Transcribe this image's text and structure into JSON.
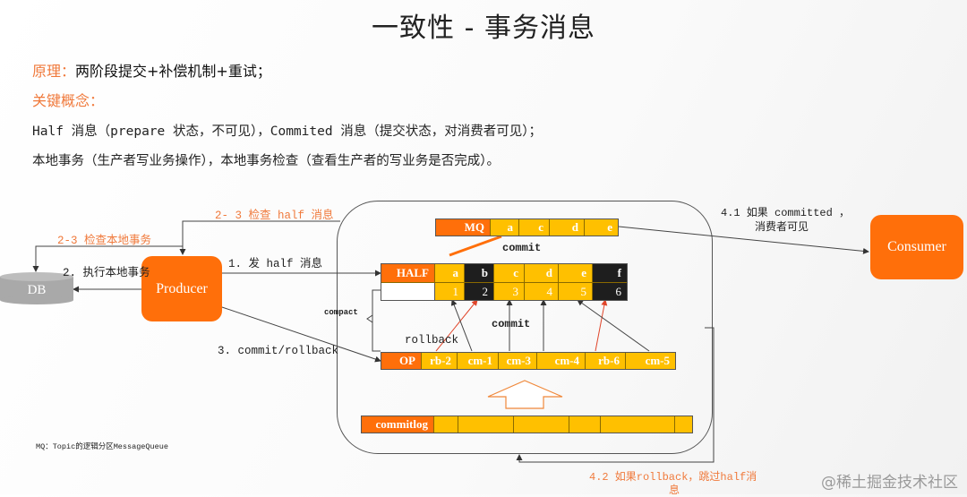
{
  "title": "一致性 - 事务消息",
  "principle": {
    "label": "原理：",
    "text": "两阶段提交+补偿机制+重试；"
  },
  "concepts_label": "关键概念：",
  "concept_lines": [
    "Half 消息（prepare 状态，不可见），Commited 消息（提交状态，对消费者可见）；",
    "本地事务（生产者写业务操作），本地事务检查（查看生产者的写业务是否完成）。"
  ],
  "diagram": {
    "db_label": "DB",
    "producer_label": "Producer",
    "consumer_label": "Consumer",
    "edge_labels": {
      "check_half": "2- 3 检查 half 消息",
      "check_local": "2-3 检查本地事务",
      "exec_local": "2. 执行本地事务",
      "send_half": "1. 发 half 消息",
      "commit_rollback": "3. commit/rollback",
      "if_committed_1": "4.1 如果 committed ，",
      "if_committed_2": "消费者可见",
      "if_rollback_1": "4.2 如果rollback，跳过half消",
      "if_rollback_2": "息"
    },
    "mq_bar": {
      "label": "MQ",
      "cells": [
        "a",
        "c",
        "d",
        "e"
      ]
    },
    "half_bar": {
      "label": "HALF",
      "cells": [
        {
          "letter": "a",
          "offset": "1",
          "state": "committed"
        },
        {
          "letter": "b",
          "offset": "2",
          "state": "rolled-back"
        },
        {
          "letter": "c",
          "offset": "3",
          "state": "committed"
        },
        {
          "letter": "d",
          "offset": "4",
          "state": "committed"
        },
        {
          "letter": "e",
          "offset": "5",
          "state": "committed"
        },
        {
          "letter": "f",
          "offset": "6",
          "state": "rolled-back"
        }
      ]
    },
    "op_bar": {
      "label": "OP",
      "cells": [
        "rb-2",
        "cm-1",
        "cm-3",
        "cm-4",
        "rb-6",
        "cm-5"
      ]
    },
    "commitlog_bar": {
      "label": "commitlog",
      "cell_count": 6
    },
    "inner_labels": {
      "commit_top": "commit",
      "commit_mid": "commit",
      "rollback": "rollback",
      "compact": "compact"
    },
    "footnote": "MQ：Topic的逻辑分区MessageQueue"
  },
  "colors": {
    "accent_orange": "#ff6f0a",
    "cell_yellow": "#ffc000",
    "rollback_black": "#1e1e1e",
    "label_orange": "#f07a3c",
    "db_gray": "#a9a9a9"
  },
  "watermark": "@稀土掘金技术社区"
}
